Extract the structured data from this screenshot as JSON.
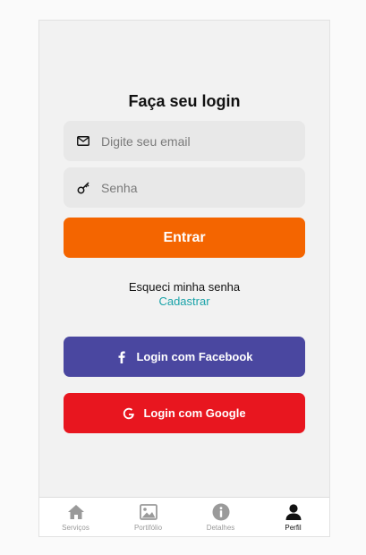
{
  "login": {
    "title": "Faça seu login",
    "email_placeholder": "Digite seu email",
    "password_placeholder": "Senha",
    "submit_label": "Entrar",
    "forgot_label": "Esqueci minha senha",
    "signup_label": "Cadastrar",
    "facebook_label": "Login com Facebook",
    "google_label": "Login com Google"
  },
  "tabbar": {
    "items": [
      {
        "label": "Serviços",
        "icon": "home-icon",
        "active": false
      },
      {
        "label": "Portifólio",
        "icon": "gallery-icon",
        "active": false
      },
      {
        "label": "Detalhes",
        "icon": "info-icon",
        "active": false
      },
      {
        "label": "Perfil",
        "icon": "person-icon",
        "active": true
      }
    ]
  },
  "colors": {
    "primary_orange": "#f46500",
    "facebook_blue": "#4a47a0",
    "google_red": "#e8161f",
    "link_teal": "#1aa3a9"
  }
}
